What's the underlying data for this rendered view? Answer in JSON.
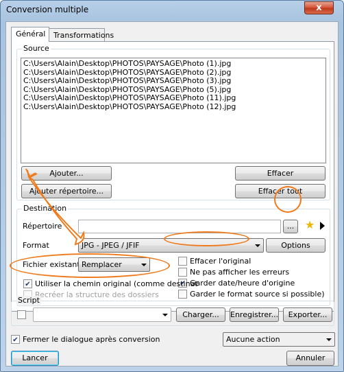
{
  "window": {
    "title": "Conversion multiple",
    "close_glyph": "x"
  },
  "tabs": [
    {
      "label": "Général"
    },
    {
      "label": "Transformations"
    }
  ],
  "source": {
    "label": "Source",
    "files": [
      "C:\\Users\\Alain\\Desktop\\PHOTOS\\PAYSAGE\\Photo (1).jpg",
      "C:\\Users\\Alain\\Desktop\\PHOTOS\\PAYSAGE\\Photo (2).jpg",
      "C:\\Users\\Alain\\Desktop\\PHOTOS\\PAYSAGE\\Photo (3).jpg",
      "C:\\Users\\Alain\\Desktop\\PHOTOS\\PAYSAGE\\Photo (5).jpg",
      "C:\\Users\\Alain\\Desktop\\PHOTOS\\PAYSAGE\\Photo (11).jpg",
      "C:\\Users\\Alain\\Desktop\\PHOTOS\\PAYSAGE\\Photo (12).jpg"
    ],
    "add_label": "Ajouter...",
    "add_dir_label": "Ajouter répertoire...",
    "clear_label": "Effacer",
    "clear_all_label": "Effacer tout"
  },
  "destination": {
    "label": "Destination",
    "dir_label": "Répertoire",
    "dir_value": "",
    "browse_label": "...",
    "format_label": "Format",
    "format_value": "JPG - JPEG / JFIF",
    "options_label": "Options",
    "existing_label": "Fichier existant",
    "existing_value": "Remplacer",
    "use_original_path": "Utiliser la chemin original (comme destinat",
    "recreate_structure": "Recréer la structure des dossiers",
    "delete_original": "Effacer l'original",
    "no_errors": "Ne pas afficher les erreurs",
    "keep_date": "Garder date/heure d'origine",
    "keep_format": "Garder le format source si possible)"
  },
  "script": {
    "label": "Script",
    "value": "",
    "load_label": "Charger...",
    "save_label": "Enregistrer...",
    "export_label": "Exporter..."
  },
  "footer": {
    "close_after_label": "Fermer le dialogue après conversion",
    "action_value": "Aucune action",
    "run_label": "Lancer",
    "cancel_label": "Annuler"
  },
  "colors": {
    "annotation": "#f07a1b",
    "checkmark": "#1b3a75"
  }
}
